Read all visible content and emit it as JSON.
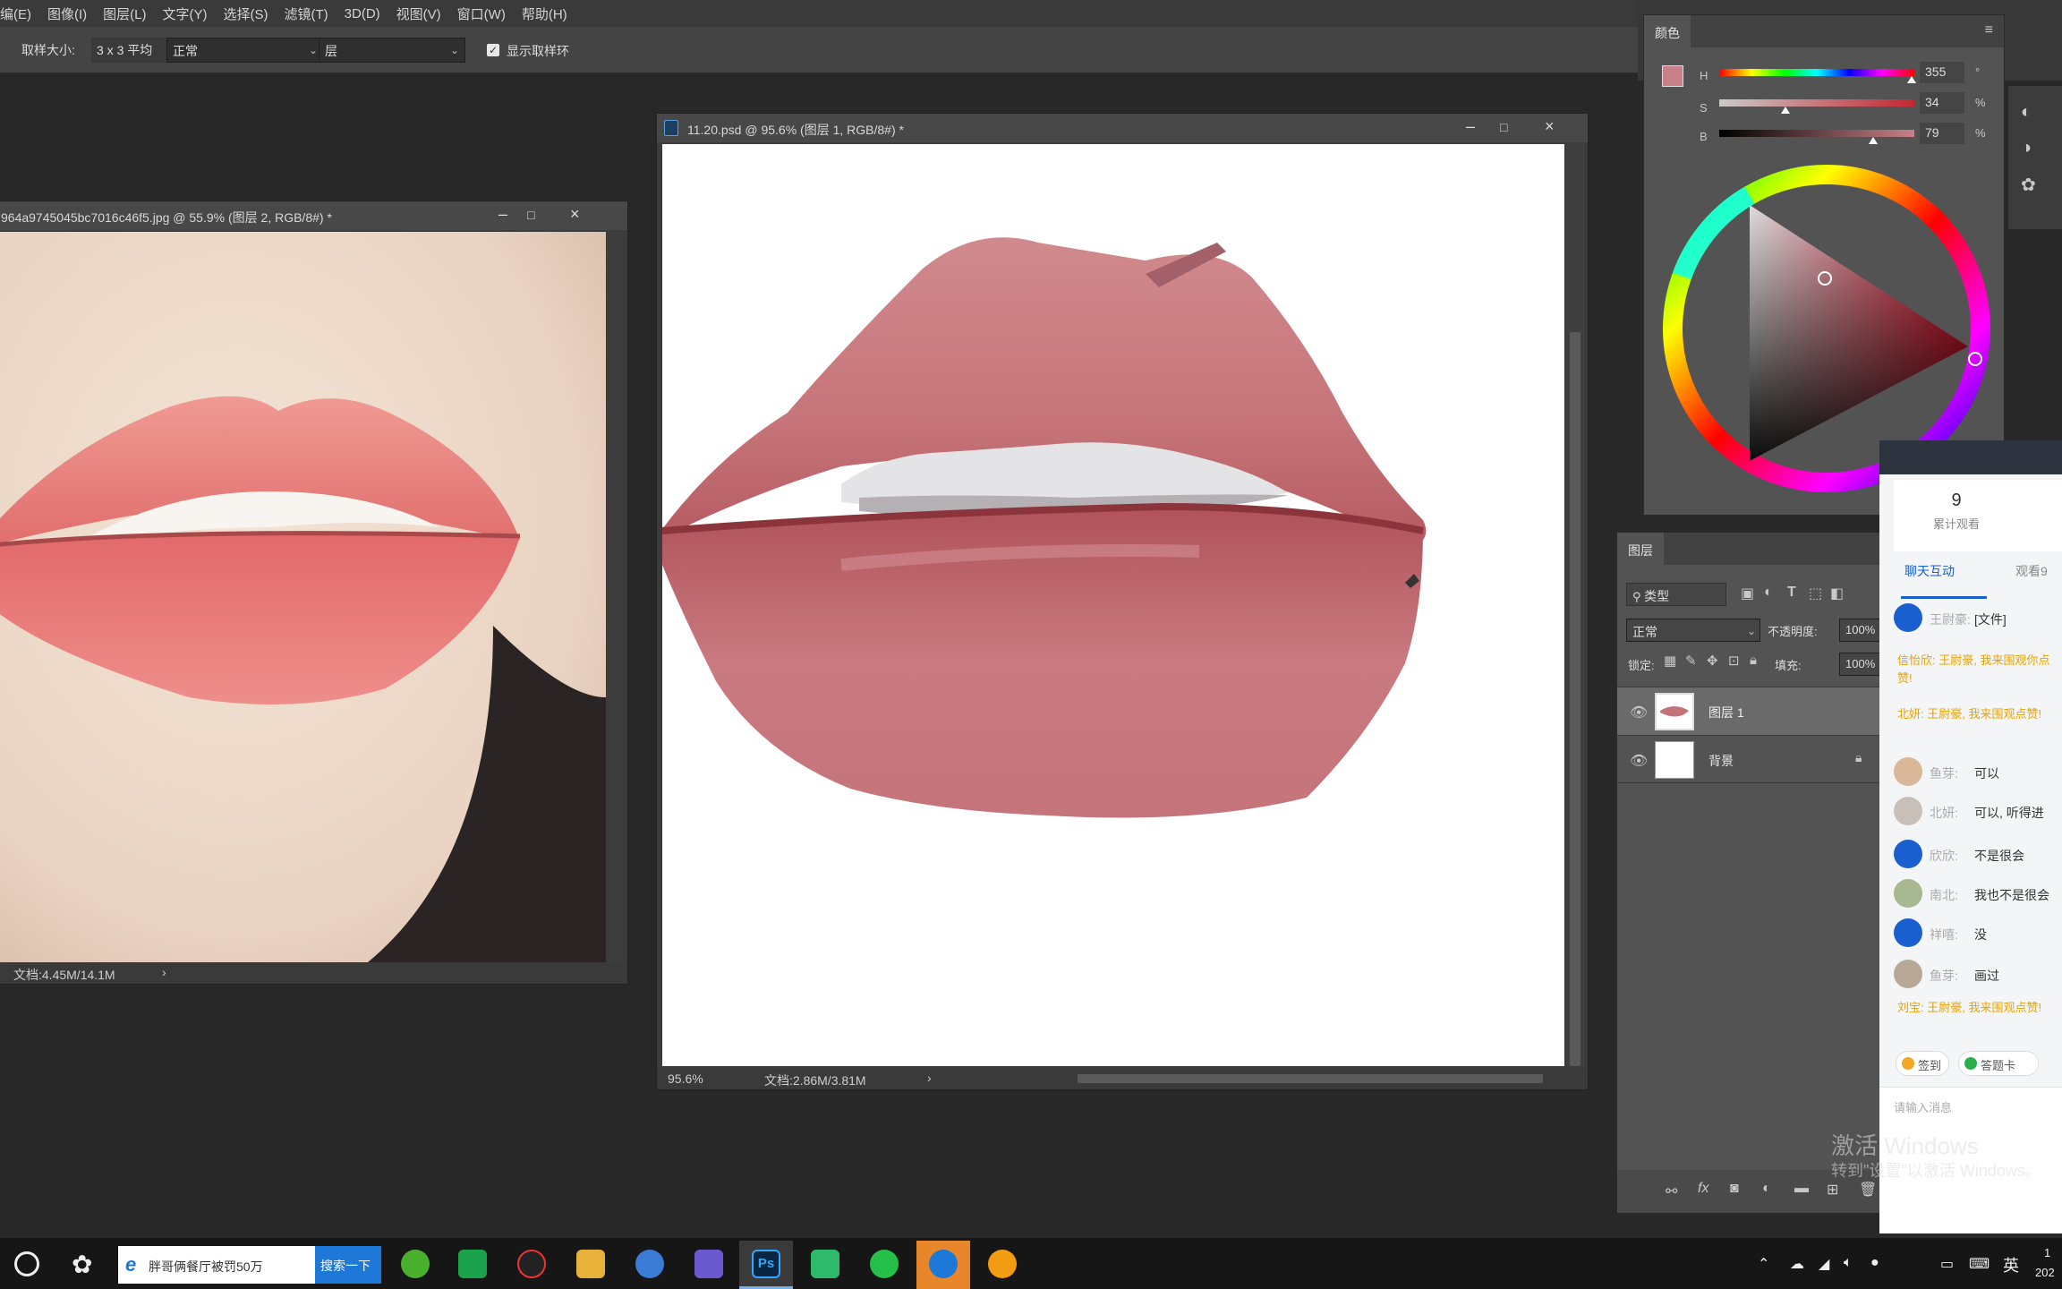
{
  "menu": [
    "编(E)",
    "图像(I)",
    "图层(L)",
    "文字(Y)",
    "选择(S)",
    "滤镜(T)",
    "3D(D)",
    "视图(V)",
    "窗口(W)",
    "帮助(H)"
  ],
  "options": {
    "sample_size_label": "取样大小:",
    "sample_size_value": "3 x 3 平均",
    "mode_value": "正常",
    "layer_value": "层",
    "show_ring_label": "显示取样环"
  },
  "ref_window": {
    "title": "964a9745045bc7016c46f5.jpg @ 55.9% (图层 2, RGB/8#) *",
    "status": "文档:4.45M/14.1M"
  },
  "main_window": {
    "title": "11.20.psd @ 95.6% (图层 1, RGB/8#) *",
    "zoom": "95.6%",
    "status": "文档:2.86M/3.81M"
  },
  "color_panel": {
    "tab": "颜色",
    "h_label": "H",
    "h_value": "355",
    "h_unit": "°",
    "h_level": 0.986,
    "s_label": "S",
    "s_value": "34",
    "s_unit": "%",
    "s_level": 0.34,
    "b_label": "B",
    "b_value": "79",
    "b_unit": "%",
    "b_level": 0.79,
    "fg_color": "#c97f87",
    "bg_color": "#8a2a2c"
  },
  "layers_panel": {
    "tab": "图层",
    "filter": "类型",
    "blend": "正常",
    "opacity_label": "不透明度:",
    "opacity_value": "100%",
    "lock_label": "锁定:",
    "fill_label": "填充:",
    "fill_value": "100%",
    "layers": [
      {
        "name": "图层 1"
      },
      {
        "name": "背景"
      }
    ]
  },
  "chat": {
    "count": "9",
    "count_label": "累计观看",
    "tab_active": "聊天互动",
    "tab_other": "观看9",
    "messages": [
      {
        "name": "王尉豪:",
        "text": "[文件]",
        "color": "#666"
      },
      {
        "name": "",
        "text": "信怡欣: 王尉豪, 我来围观你点赞!",
        "color": "#e8a300"
      },
      {
        "name": "",
        "text": "北妍: 王尉豪, 我来围观点赞!",
        "color": "#e8a300"
      },
      {
        "name": "鱼芽:",
        "text": "可以",
        "color": "#666"
      },
      {
        "name": "北妍:",
        "text": "可以, 听得进",
        "color": "#666"
      },
      {
        "name": "欣欣:",
        "text": "不是很会",
        "color": "#666"
      },
      {
        "name": "南北:",
        "text": "我也不是很会",
        "color": "#666"
      },
      {
        "name": "祥嘻:",
        "text": "没",
        "color": "#666"
      },
      {
        "name": "鱼芽:",
        "text": "画过",
        "color": "#666"
      },
      {
        "name": "",
        "text": "刘宝: 王尉豪, 我来围观点赞!",
        "color": "#e8a300"
      }
    ],
    "btn_signin": "签到",
    "btn_lottery": "答题卡",
    "input_placeholder": "请输入消息"
  },
  "watermark": {
    "line1": "激活 Windows",
    "line2": "转到\"设置\"以激活 Windows。"
  },
  "taskbar": {
    "search_text": "胖哥俩餐厅被罚50万",
    "search_button": "搜索一下",
    "ime": "英",
    "clock_top": "1",
    "clock_bottom": "202"
  }
}
